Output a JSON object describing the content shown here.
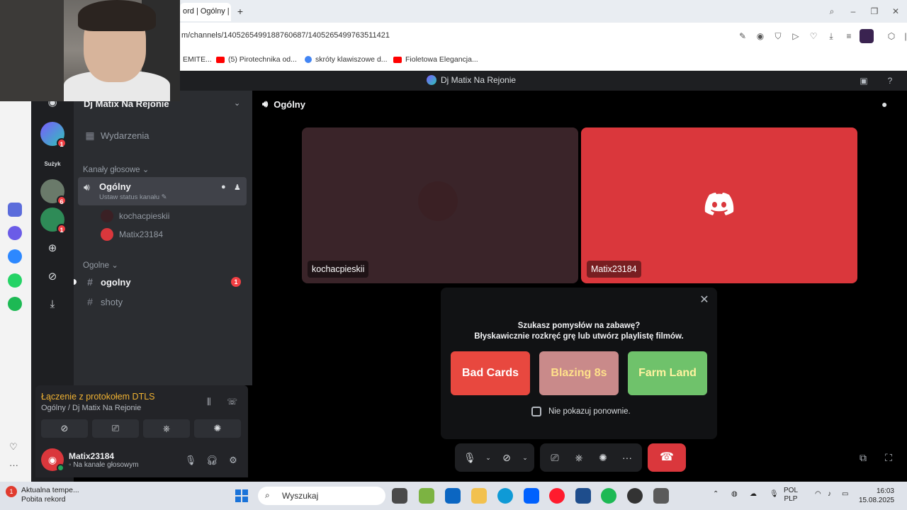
{
  "browser": {
    "tab_title": "ord | Ogólny | ",
    "url": "m/channels/1405265499188760687/1405265499763511421",
    "bookmarks": [
      {
        "label": "EMITE...",
        "color": "#e9edf2"
      },
      {
        "label": "(5) Pirotechnika od...",
        "color": "#ff0000"
      },
      {
        "label": "skróty klawiszowe d...",
        "color": "#4285f4"
      },
      {
        "label": "Fioletowa Elegancja...",
        "color": "#ff0000"
      }
    ]
  },
  "discord": {
    "window_title": "Dj Matix Na Rejonie",
    "guild_name": "Dj Matix Na Rejonie",
    "events_label": "Wydarzenia",
    "category_voice": "Kanały głosowe",
    "voice_channel": {
      "name": "Ogólny",
      "status_hint": "Ustaw status kanału",
      "users": [
        "kochacpieskii",
        "Matix23184"
      ]
    },
    "category_text": "Ogolne",
    "text_channels": [
      {
        "name": "ogolny",
        "mentions": "1"
      },
      {
        "name": "shoty",
        "mentions": ""
      }
    ],
    "server_rail": {
      "badges": [
        "1",
        "6",
        "1"
      ],
      "text_server": "Sużyk"
    },
    "voice_panel": {
      "status": "Łączenie z protokołem DTLS",
      "location": "Ogólny / Dj Matix Na Rejonie"
    },
    "user_panel": {
      "username": "Matix23184",
      "status": "Na kanale głosowym"
    },
    "stage": {
      "channel": "Ogólny",
      "tiles": [
        {
          "name": "kochacpieskii",
          "bg": "#3a2429"
        },
        {
          "name": "Matix23184",
          "bg": "#da373c"
        }
      ]
    },
    "promo": {
      "title_line1": "Szukasz pomysłów na zabawę?",
      "title_line2": "Błyskawicznie rozkręć grę lub utwórz playlistę filmów.",
      "games": [
        "Bad Cards",
        "Blazing 8s",
        "Farm Land"
      ],
      "dont_show": "Nie pokazuj ponownie."
    }
  },
  "taskbar": {
    "weather_line1": "Aktualna tempe...",
    "weather_line2": "Pobita rekord",
    "weather_badge": "1",
    "search_placeholder": "Wyszukaj",
    "lang_line1": "POL",
    "lang_line2": "PLP",
    "time": "16:03",
    "date": "15.08.2025"
  }
}
